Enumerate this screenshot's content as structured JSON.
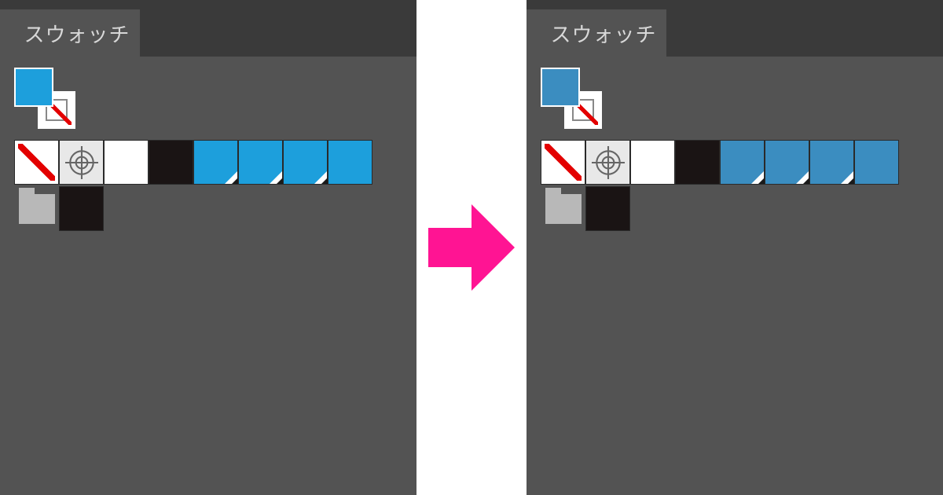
{
  "panels": {
    "left": {
      "tab_label": "スウォッチ",
      "fill_color": "#1d9fdc",
      "swatches": [
        {
          "type": "none"
        },
        {
          "type": "registration"
        },
        {
          "type": "white"
        },
        {
          "type": "black"
        },
        {
          "type": "color",
          "color": "#1d9fdc",
          "global": true
        },
        {
          "type": "color",
          "color": "#1d9fdc",
          "global": true
        },
        {
          "type": "color",
          "color": "#1d9fdc",
          "global": true
        },
        {
          "type": "color",
          "color": "#1d9fdc",
          "global": false
        }
      ],
      "row2": [
        {
          "type": "folder"
        },
        {
          "type": "black"
        }
      ]
    },
    "right": {
      "tab_label": "スウォッチ",
      "fill_color": "#3b8dc0",
      "swatches": [
        {
          "type": "none"
        },
        {
          "type": "registration"
        },
        {
          "type": "white"
        },
        {
          "type": "black"
        },
        {
          "type": "color",
          "color": "#3b8dc0",
          "global": true
        },
        {
          "type": "color",
          "color": "#3b8dc0",
          "global": true
        },
        {
          "type": "color",
          "color": "#3b8dc0",
          "global": true
        },
        {
          "type": "color",
          "color": "#3b8dc0",
          "global": false
        }
      ],
      "row2": [
        {
          "type": "folder"
        },
        {
          "type": "black"
        }
      ]
    }
  }
}
